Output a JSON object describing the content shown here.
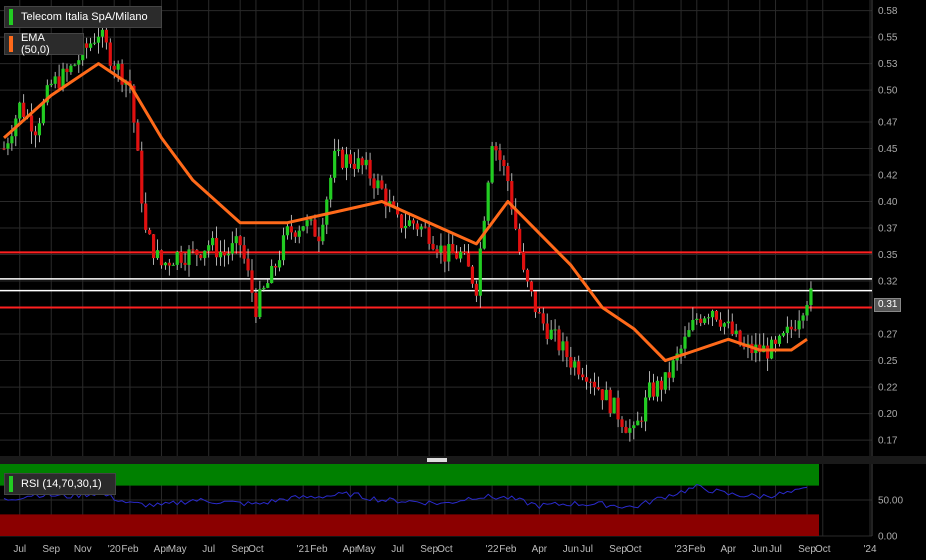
{
  "legend": {
    "symbol": {
      "label": "Telecom Italia SpA/Milano",
      "color": "#22cc22"
    },
    "ema": {
      "label": "EMA (50,0)",
      "color": "#ff6a1a"
    },
    "rsi": {
      "label": "RSI (14,70,30,1)",
      "color": "#2222cc"
    }
  },
  "last_price_tag": "0.31",
  "chart_data": [
    {
      "type": "candlestick",
      "ylim": [
        0.16,
        0.59
      ],
      "y_ticks": [
        "0.58",
        "0.55",
        "0.53",
        "0.50",
        "0.47",
        "0.45",
        "0.42",
        "0.40",
        "0.37",
        "0.35",
        "0.32",
        "0.30",
        "0.27",
        "0.25",
        "0.22",
        "0.20",
        "0.17"
      ],
      "y_tick_values": [
        0.58,
        0.555,
        0.53,
        0.505,
        0.475,
        0.45,
        0.425,
        0.4,
        0.375,
        0.35,
        0.325,
        0.3,
        0.275,
        0.25,
        0.225,
        0.2,
        0.175
      ],
      "x_ticks": [
        "Jul",
        "Sep",
        "Nov",
        "'20",
        "Feb",
        "Apr",
        "May",
        "Jul",
        "Sep",
        "Oct",
        "'21",
        "Feb",
        "Apr",
        "May",
        "Jul",
        "Sep",
        "Oct",
        "'22",
        "Feb",
        "Apr",
        "Jun",
        "Jul",
        "Sep",
        "Oct",
        "'23",
        "Feb",
        "Apr",
        "Jun",
        "Jul",
        "Sep",
        "Oct",
        "'24"
      ],
      "x_tick_dates": [
        "2019-07",
        "2019-09",
        "2019-11",
        "2020-01",
        "2020-02",
        "2020-04",
        "2020-05",
        "2020-07",
        "2020-09",
        "2020-10",
        "2021-01",
        "2021-02",
        "2021-04",
        "2021-05",
        "2021-07",
        "2021-09",
        "2021-10",
        "2022-01",
        "2022-02",
        "2022-04",
        "2022-06",
        "2022-07",
        "2022-09",
        "2022-10",
        "2023-01",
        "2023-02",
        "2023-04",
        "2023-06",
        "2023-07",
        "2023-09",
        "2023-10",
        "2024-01"
      ],
      "horizontal_lines": [
        {
          "value": 0.352,
          "color": "#ff2020"
        },
        {
          "value": 0.327,
          "color": "#ffffff"
        },
        {
          "value": 0.316,
          "color": "#ffffff"
        },
        {
          "value": 0.3,
          "color": "#ff2020"
        }
      ],
      "close_series": {
        "dates": [
          "2019-06",
          "2019-07",
          "2019-08",
          "2019-09",
          "2019-10",
          "2019-11",
          "2019-12",
          "2020-01",
          "2020-02",
          "2020-03",
          "2020-04",
          "2020-05",
          "2020-06",
          "2020-07",
          "2020-08",
          "2020-09",
          "2020-10",
          "2020-11",
          "2020-12",
          "2021-01",
          "2021-02",
          "2021-03",
          "2021-04",
          "2021-05",
          "2021-06",
          "2021-07",
          "2021-08",
          "2021-09",
          "2021-10",
          "2021-11",
          "2021-12",
          "2022-01",
          "2022-02",
          "2022-03",
          "2022-04",
          "2022-05",
          "2022-06",
          "2022-07",
          "2022-08",
          "2022-09",
          "2022-10",
          "2022-11",
          "2022-12",
          "2023-01",
          "2023-02",
          "2023-03",
          "2023-04",
          "2023-05",
          "2023-06",
          "2023-07",
          "2023-08",
          "2023-09"
        ],
        "values": [
          0.45,
          0.49,
          0.47,
          0.51,
          0.52,
          0.54,
          0.56,
          0.53,
          0.51,
          0.37,
          0.34,
          0.35,
          0.35,
          0.36,
          0.35,
          0.36,
          0.3,
          0.33,
          0.37,
          0.38,
          0.37,
          0.44,
          0.44,
          0.43,
          0.41,
          0.38,
          0.38,
          0.37,
          0.35,
          0.35,
          0.32,
          0.46,
          0.42,
          0.33,
          0.29,
          0.27,
          0.25,
          0.24,
          0.22,
          0.2,
          0.18,
          0.22,
          0.23,
          0.26,
          0.29,
          0.3,
          0.28,
          0.26,
          0.26,
          0.26,
          0.28,
          0.31
        ]
      },
      "ema_series": {
        "name": "EMA (50,0)",
        "dates": [
          "2019-06",
          "2019-09",
          "2019-12",
          "2020-02",
          "2020-04",
          "2020-06",
          "2020-09",
          "2020-12",
          "2021-03",
          "2021-06",
          "2021-09",
          "2021-12",
          "2022-02",
          "2022-04",
          "2022-06",
          "2022-08",
          "2022-10",
          "2022-12",
          "2023-02",
          "2023-04",
          "2023-06",
          "2023-08",
          "2023-09"
        ],
        "values": [
          0.46,
          0.5,
          0.53,
          0.51,
          0.46,
          0.42,
          0.38,
          0.38,
          0.39,
          0.4,
          0.38,
          0.36,
          0.4,
          0.37,
          0.34,
          0.3,
          0.28,
          0.25,
          0.26,
          0.27,
          0.26,
          0.26,
          0.27
        ]
      }
    },
    {
      "type": "line",
      "name": "RSI (14,70,30,1)",
      "ylim": [
        0,
        100
      ],
      "y_ticks": [
        "50.00",
        "0.00"
      ],
      "y_tick_values": [
        50,
        0
      ],
      "bands": [
        {
          "from": 70,
          "to": 100,
          "color": "#008000"
        },
        {
          "from": 0,
          "to": 30,
          "color": "#8b0000"
        }
      ],
      "dates": [
        "2019-06",
        "2019-08",
        "2019-10",
        "2019-12",
        "2020-02",
        "2020-04",
        "2020-06",
        "2020-08",
        "2020-10",
        "2020-12",
        "2021-02",
        "2021-04",
        "2021-06",
        "2021-08",
        "2021-10",
        "2021-12",
        "2022-02",
        "2022-04",
        "2022-06",
        "2022-08",
        "2022-10",
        "2022-12",
        "2023-02",
        "2023-04",
        "2023-06",
        "2023-08",
        "2023-09"
      ],
      "values": [
        50,
        58,
        55,
        60,
        45,
        42,
        50,
        47,
        44,
        52,
        55,
        58,
        50,
        48,
        45,
        55,
        53,
        42,
        45,
        44,
        40,
        55,
        68,
        58,
        55,
        60,
        65
      ]
    }
  ]
}
